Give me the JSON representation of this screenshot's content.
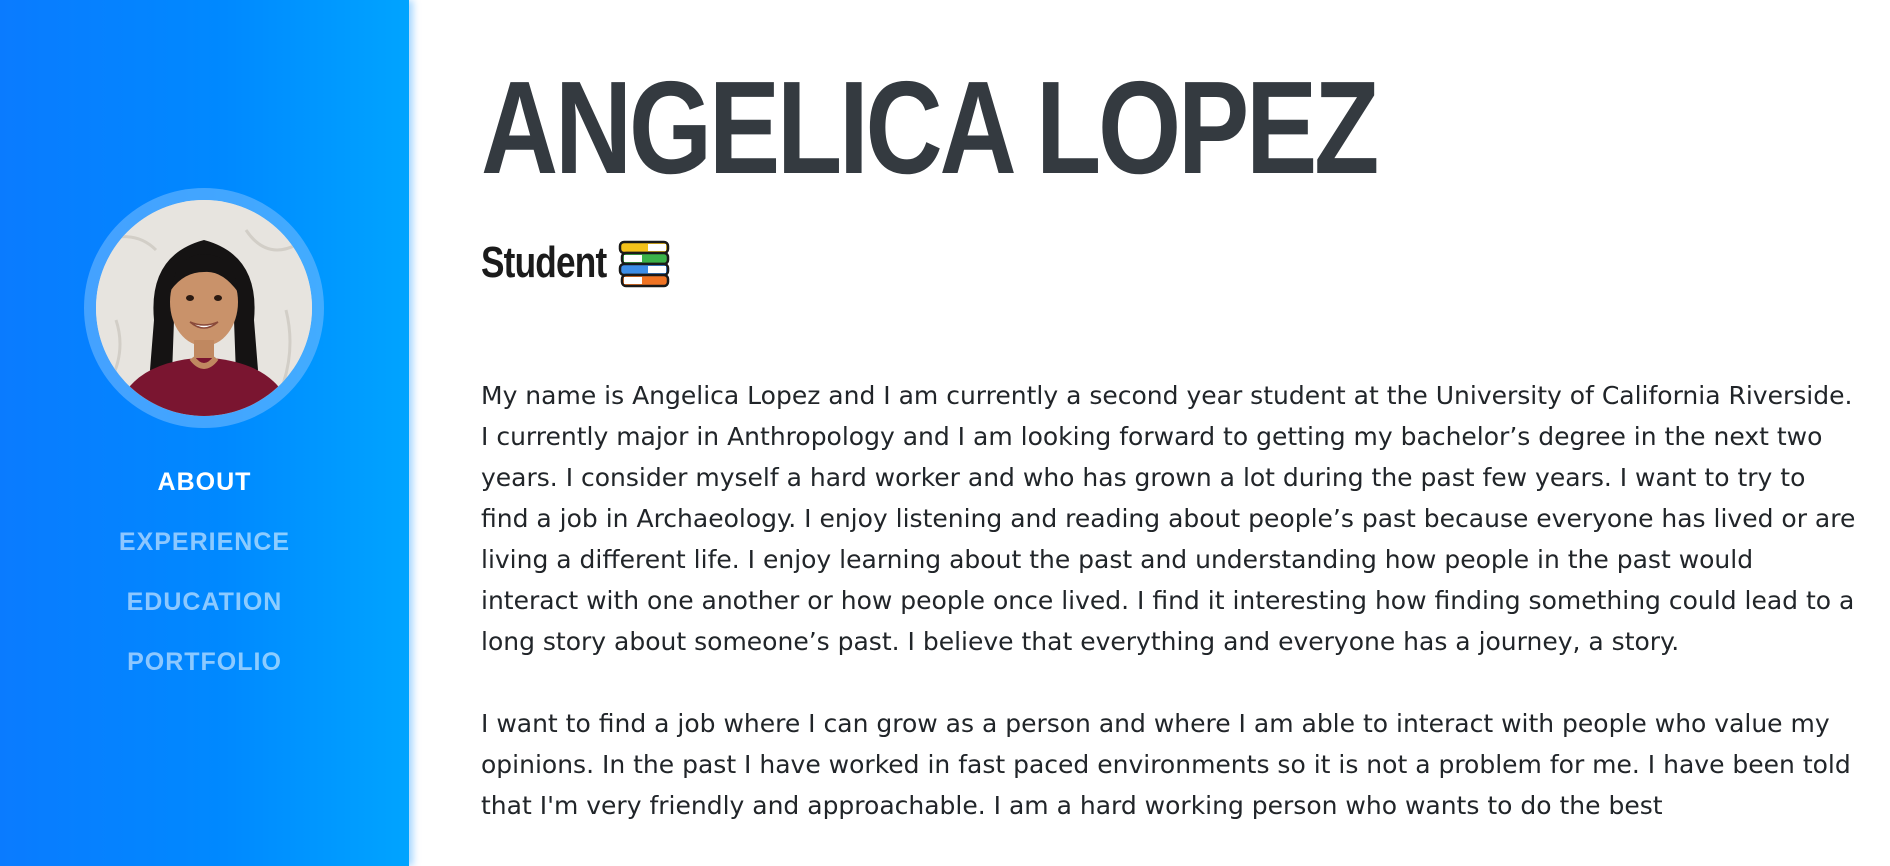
{
  "profile": {
    "name": "ANGELICA LOPEZ",
    "subtitle": "Student",
    "subtitle_icon": "books-icon",
    "avatar_icon": "profile-photo"
  },
  "sidebar": {
    "background_colors": [
      "#0a7bff",
      "#00a4ff"
    ],
    "nav": [
      {
        "label": "ABOUT",
        "active": true
      },
      {
        "label": "EXPERIENCE",
        "active": false
      },
      {
        "label": "EDUCATION",
        "active": false
      },
      {
        "label": "PORTFOLIO",
        "active": false
      }
    ]
  },
  "about": {
    "paragraphs": [
      "My name is Angelica Lopez and I am currently a second year student at the University of California Riverside. I currently major in Anthropology and I am looking forward to getting my bachelor’s degree in the next two years. I consider myself a hard worker and who has grown a lot during the past few years. I want to try to find a job in Archaeology. I enjoy listening and reading about people’s past because everyone has lived or are living a different life. I enjoy learning about the past and understanding how people in the past would interact with one another or how people once lived. I find it interesting how finding something could lead to a long story about someone’s past. I believe that everything and everyone has a journey, a story.",
      "I want to find a job where I can grow as a person and where I am able to interact with people who value my opinions. In the past I have worked in fast paced environments so it is not a problem for me. I have been told that I'm very friendly and approachable. I am a hard working person who wants to do the best"
    ]
  },
  "colors": {
    "heading": "#343a40",
    "body_text": "#212529",
    "nav_active": "#ffffff",
    "nav_inactive": "rgba(255,255,255,0.55)"
  }
}
